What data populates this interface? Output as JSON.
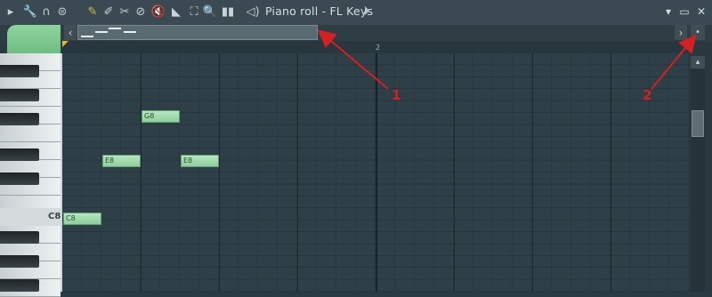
{
  "toolbar": {
    "title": "Piano roll - FL Keys",
    "icons": [
      "play-arrow-icon",
      "wrench-icon",
      "magnet-icon",
      "menu-circle-icon",
      "pencil-icon",
      "paint-brush-icon",
      "delete-brush-icon",
      "mute-icon",
      "speaker-mute-icon",
      "slice-icon",
      "select-icon",
      "zoom-icon",
      "playback-icon",
      "speaker-icon"
    ]
  },
  "piano_roll": {
    "bar_label": "2",
    "key_label": "C8",
    "notes": [
      {
        "label": "G8"
      },
      {
        "label": "E8"
      },
      {
        "label": "E8"
      },
      {
        "label": "C8"
      }
    ]
  },
  "annotations": {
    "one": "1",
    "two": "2"
  },
  "colors": {
    "note": "#8ccf9b",
    "arrow": "#d42020",
    "grid": "#2f3f47"
  }
}
